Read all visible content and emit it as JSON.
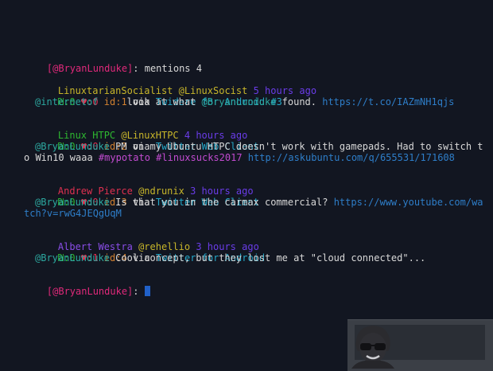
{
  "prompt_user": "[@BryanLunduke]",
  "command": "mentions 4",
  "tweets": [
    {
      "name": "LinuxtarianSocialist",
      "handle": "@LinuxSocist",
      "time": "5 hours ago",
      "retweets": "0",
      "likes": "0",
      "id": "1",
      "via_label": "via",
      "client": "Twidere for Android #3",
      "line1": [
        {
          "text": "@internetof     ",
          "cls": "c-teal"
        },
        {
          "text": "look at what ",
          "cls": "c-white"
        },
        {
          "text": "@BryanLunduke",
          "cls": "c-teal"
        },
        {
          "text": " found. ",
          "cls": "c-white"
        },
        {
          "text": "https://t.co/IAZmNH1qjs",
          "cls": "c-blue"
        }
      ],
      "line2": []
    },
    {
      "name": "Linux HTPC",
      "handle": "@LinuxHTPC",
      "time": "4 hours ago",
      "retweets": "0",
      "likes": "0",
      "id": "2",
      "via_label": "via",
      "client": "Twitter Web Client",
      "line1": [
        {
          "text": "@BryanLunduke",
          "cls": "c-teal"
        },
        {
          "text": " PM on my Ubuntu HTPC doesn't work with gamepads. Had to switch t",
          "cls": "c-white"
        }
      ],
      "line2": [
        {
          "text": "o Win10 waaa ",
          "cls": "c-white"
        },
        {
          "text": "#mypotato #linuxsucks2017",
          "cls": "c-magenta"
        },
        {
          "text": " ",
          "cls": "c-white"
        },
        {
          "text": "http://askubuntu.com/q/655531/171608",
          "cls": "c-blue"
        }
      ]
    },
    {
      "name": "Andrew Pierce",
      "handle": "@ndrunix",
      "time": "3 hours ago",
      "retweets": "0",
      "likes": "0",
      "id": "3",
      "via_label": "via",
      "client": "Twitter Web Client",
      "line1": [
        {
          "text": "@BryanLunduke",
          "cls": "c-teal"
        },
        {
          "text": " Is that you in the carmax commercial? ",
          "cls": "c-white"
        },
        {
          "text": "https://www.youtube.com/wa",
          "cls": "c-blue"
        }
      ],
      "line2": [
        {
          "text": "tch?v=rwG4JEQgUqM",
          "cls": "c-blue"
        }
      ]
    },
    {
      "name": "Albert Westra",
      "handle": "@rehellio",
      "time": "3 hours ago",
      "retweets": "0",
      "likes": "1",
      "id": "4",
      "via_label": "via",
      "client": "Twitter for Android",
      "line1": [
        {
          "text": "@BryanLunduke",
          "cls": "c-teal"
        },
        {
          "text": " Cool concept, but they lost me at \"cloud connected\"...",
          "cls": "c-white"
        }
      ],
      "line2": []
    }
  ],
  "glyphs": {
    "retweet": "₪",
    "heart": "♥",
    "id_label": "id"
  },
  "colors": {
    "background": "#121621",
    "prompt": "#e0297a",
    "name1": "#c8b62a",
    "name2": "#2eb830",
    "name3": "#e03050",
    "name4": "#8a4de8",
    "time": "#6a3ce8",
    "handle": "#c8b62a",
    "client": "#25a8c8",
    "mention": "#2ca8a0",
    "link": "#2e7ec9",
    "hashtag": "#c24bd0",
    "cursor": "#2060c8"
  },
  "icons": {
    "avatar": "sunglasses-avatar-icon"
  }
}
